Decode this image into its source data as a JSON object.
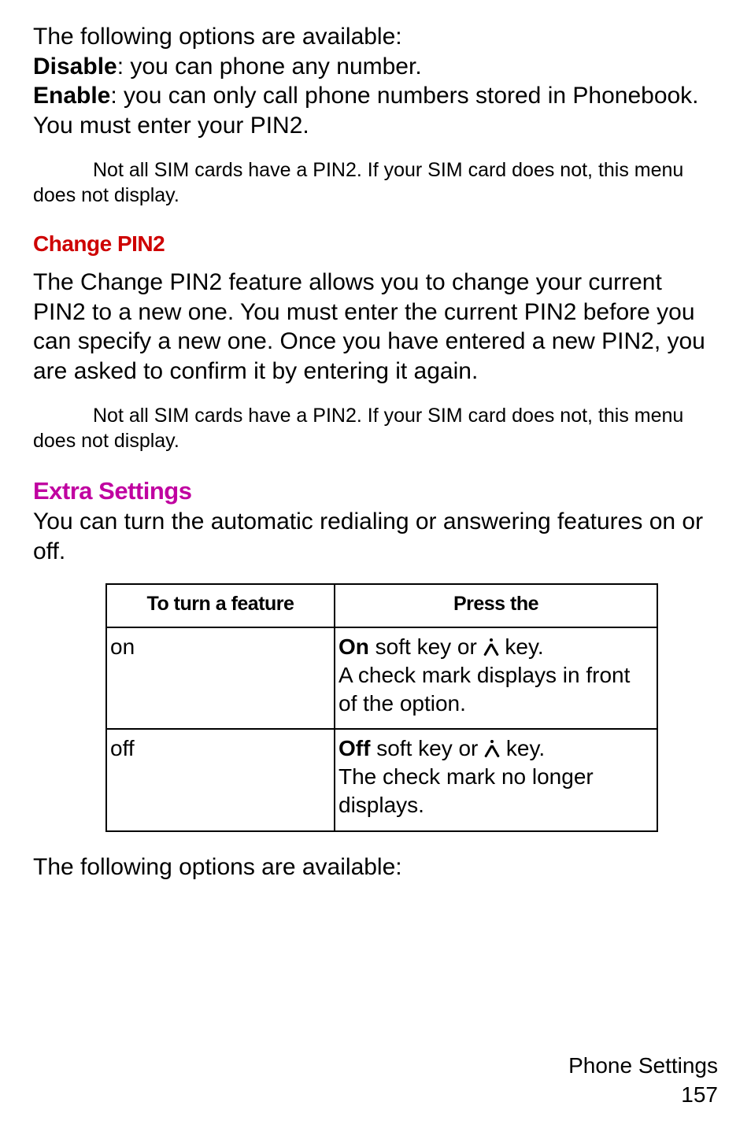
{
  "intro": {
    "line1": "The following options are available:",
    "disable_bold": "Disable",
    "disable_rest": ": you can phone any number.",
    "enable_bold": "Enable",
    "enable_rest": ": you can only call phone numbers stored in Phonebook. You must enter your PIN2."
  },
  "note1": {
    "line1": "Not all SIM cards have a PIN2. If your SIM card does not, this menu",
    "line2": "does not display."
  },
  "change_pin2": {
    "heading": "Change PIN2",
    "para": "The Change PIN2 feature allows you to change your current PIN2 to a new one. You must enter the current PIN2 before you can specify a new one. Once you have entered a new PIN2, you are asked to confirm it by entering it again."
  },
  "note2": {
    "line1": "Not all SIM cards have a PIN2. If your SIM card does not, this menu",
    "line2": "does not display."
  },
  "extra": {
    "heading": "Extra Settings",
    "para": "You can turn the automatic redialing or answering features on or off."
  },
  "table": {
    "head_left": "To turn a feature",
    "head_right": "Press the",
    "rows": [
      {
        "left": "on",
        "r_bold": "On",
        "r_mid": " soft key or ",
        "r_tail": " key.",
        "r_cont": "A check mark displays in front of the option."
      },
      {
        "left": "off",
        "r_bold": "Off",
        "r_mid": " soft key or ",
        "r_tail": " key.",
        "r_cont": "The check mark no longer displays."
      }
    ]
  },
  "outro": "The following options are available:",
  "footer": {
    "title": "Phone Settings",
    "page": "157"
  }
}
